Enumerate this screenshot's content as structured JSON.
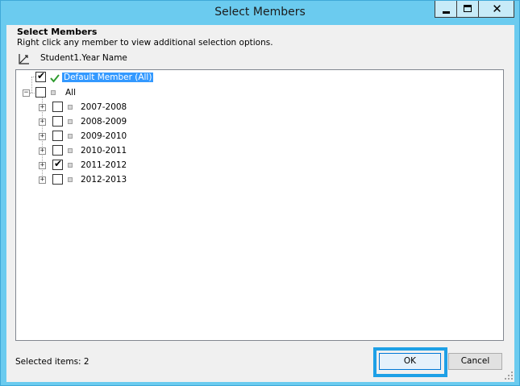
{
  "window": {
    "title": "Select Members",
    "close_glyph": "✕"
  },
  "header": {
    "heading": "Select Members",
    "instruction": "Right click any member to view additional selection options.",
    "hierarchy_icon": "axis-chart-icon",
    "hierarchy_name": "Student1.Year Name"
  },
  "tree": {
    "default_member": {
      "label": "Default Member (All)",
      "checked": true,
      "selected": true,
      "icon": "green-check-icon"
    },
    "root": {
      "label": "All",
      "checked": false,
      "expanded": true,
      "expander": "−"
    },
    "children": [
      {
        "label": "2007-2008",
        "checked": false,
        "expander": "+"
      },
      {
        "label": "2008-2009",
        "checked": false,
        "expander": "+"
      },
      {
        "label": "2009-2010",
        "checked": false,
        "expander": "+"
      },
      {
        "label": "2010-2011",
        "checked": false,
        "expander": "+"
      },
      {
        "label": "2011-2012",
        "checked": true,
        "expander": "+"
      },
      {
        "label": "2012-2013",
        "checked": false,
        "expander": "+"
      }
    ],
    "check_glyph": "✔"
  },
  "footer": {
    "selected_items": "Selected items: 2",
    "ok_label": "OK",
    "cancel_label": "Cancel"
  },
  "colors": {
    "title_bar": "#6bcbef",
    "selection": "#3399ff",
    "ok_highlight": "#1ea0e6"
  }
}
